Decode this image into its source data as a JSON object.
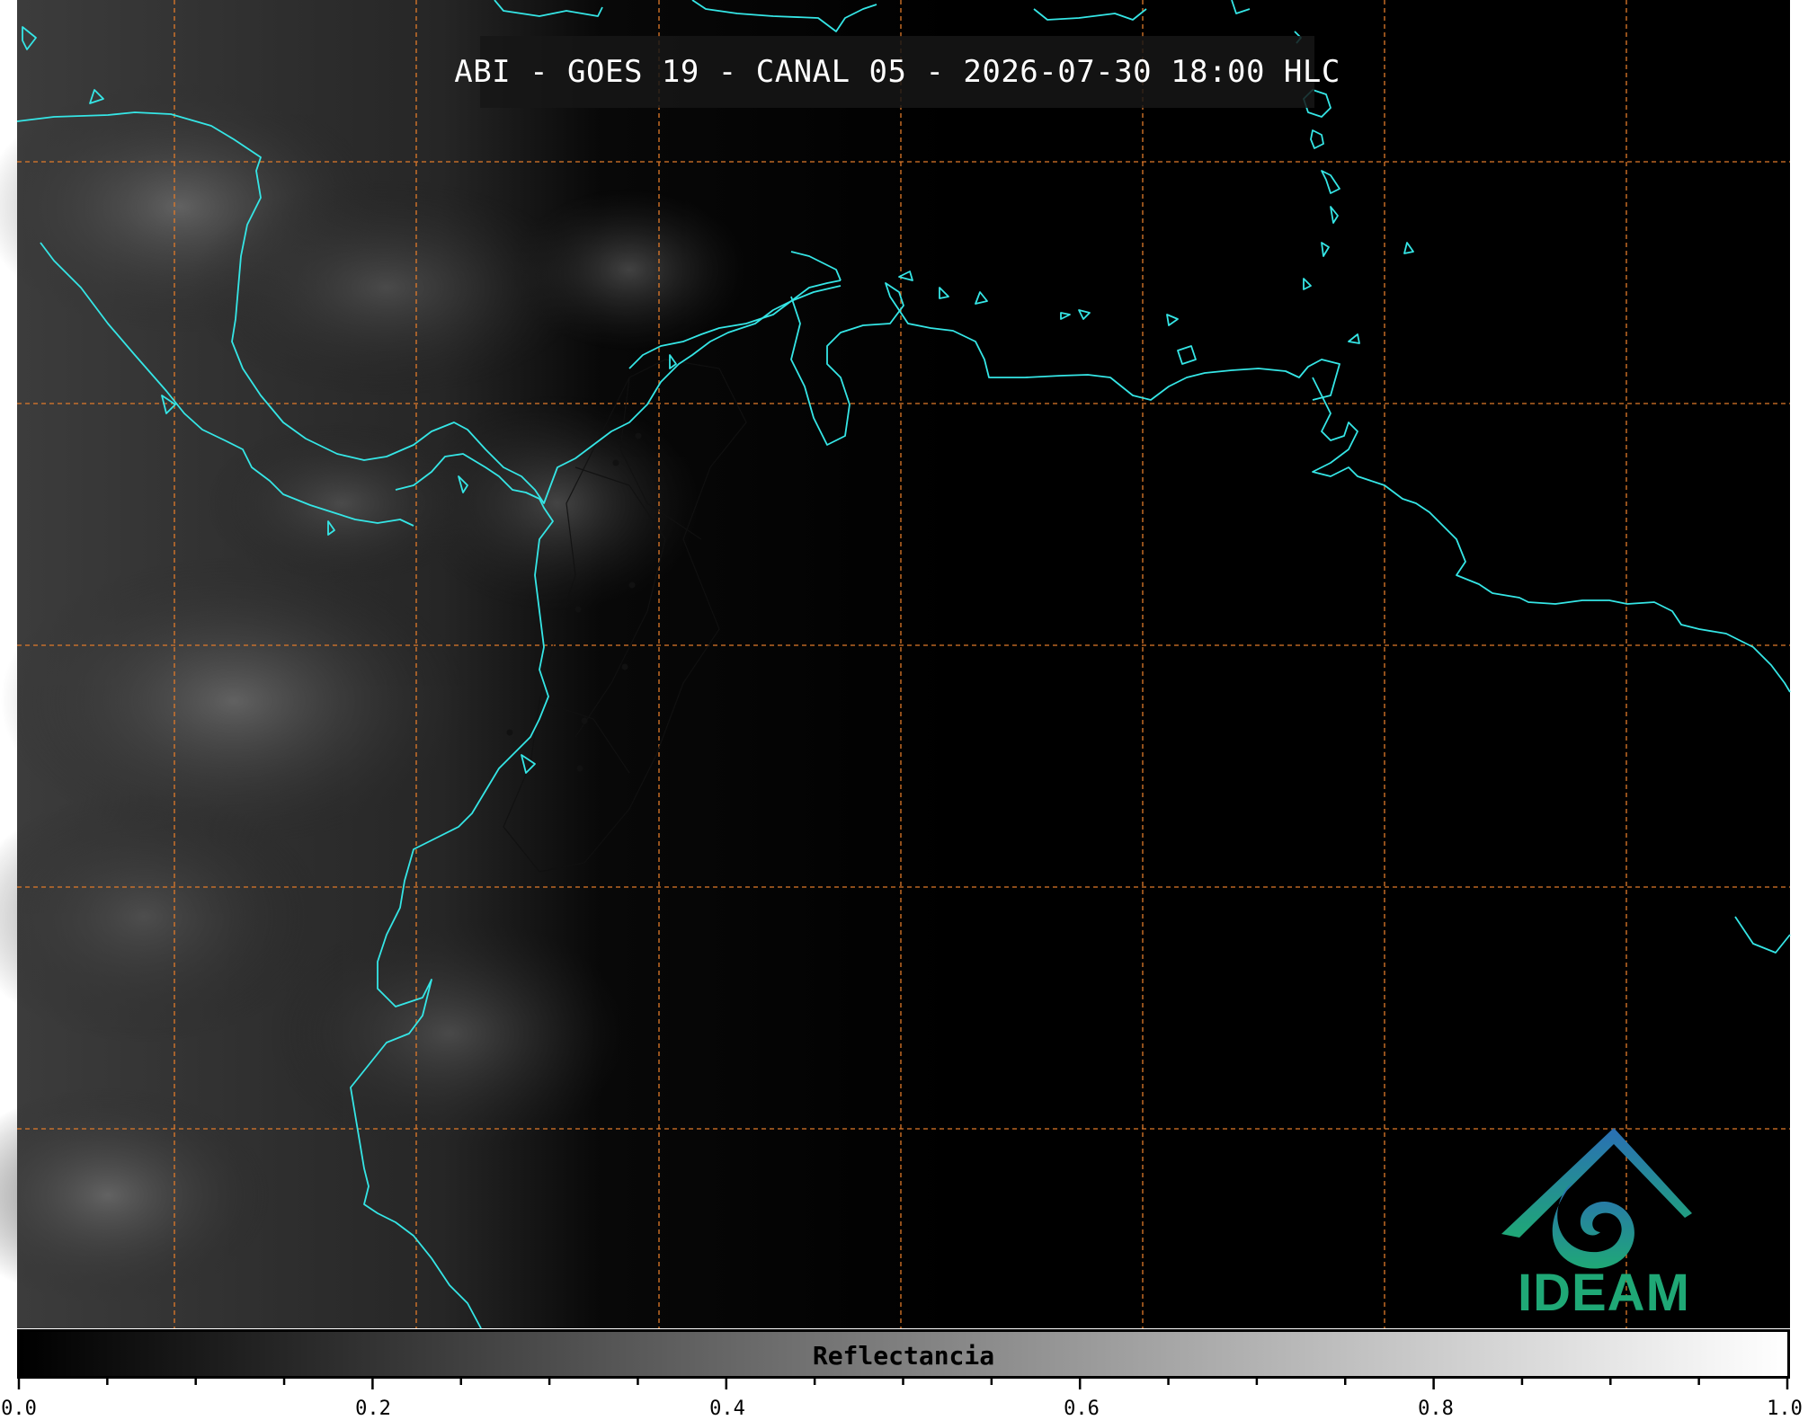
{
  "title": "ABI - GOES 19 - CANAL 05 - 2026-07-30 18:00 HLC",
  "colorbar": {
    "label": "Reflectancia",
    "min": 0.0,
    "max": 1.0,
    "ticks": [
      "0.0",
      "0.2",
      "0.4",
      "0.6",
      "0.8",
      "1.0"
    ],
    "colormap": "grayscale black-to-white"
  },
  "logo": {
    "text": "IDEAM",
    "colors": [
      "#2a6fb5",
      "#1fa876"
    ]
  },
  "map": {
    "coastline_color": "#35e6e6",
    "gridline_color": "#e07a2a",
    "background": "#000000"
  }
}
